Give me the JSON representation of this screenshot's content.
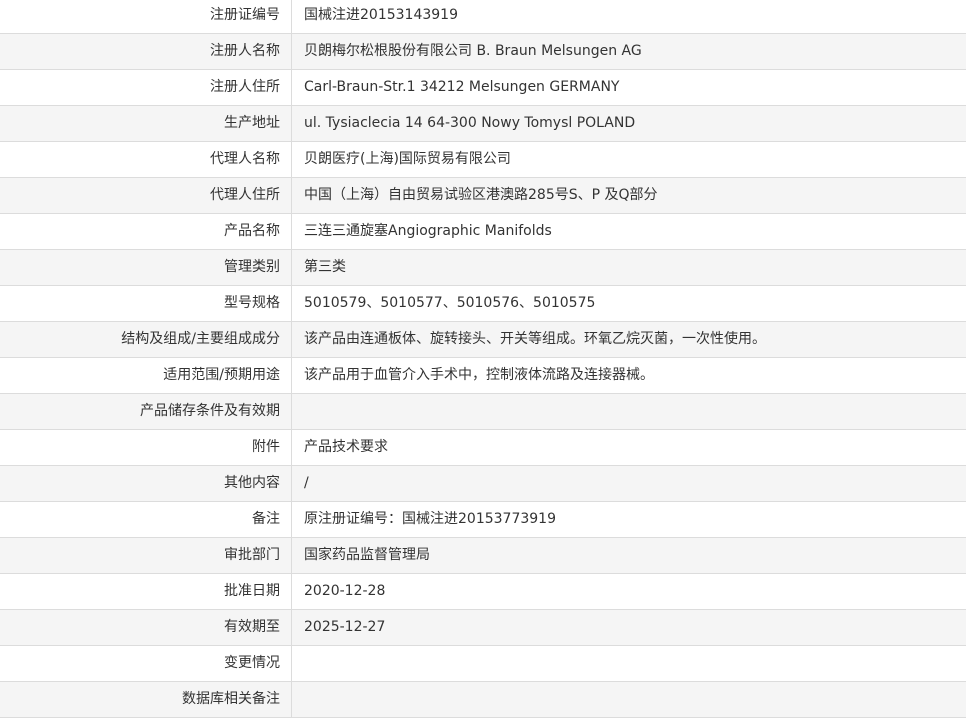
{
  "rows": [
    {
      "label": "注册证编号",
      "value": "国械注进20153143919"
    },
    {
      "label": "注册人名称",
      "value": "贝朗梅尔松根股份有限公司 B. Braun Melsungen AG"
    },
    {
      "label": "注册人住所",
      "value": "Carl-Braun-Str.1 34212 Melsungen GERMANY"
    },
    {
      "label": "生产地址",
      "value": "ul. Tysiaclecia 14 64-300 Nowy Tomysl POLAND"
    },
    {
      "label": "代理人名称",
      "value": "贝朗医疗(上海)国际贸易有限公司"
    },
    {
      "label": "代理人住所",
      "value": "中国（上海）自由贸易试验区港澳路285号S、P 及Q部分"
    },
    {
      "label": "产品名称",
      "value": "三连三通旋塞Angiographic Manifolds"
    },
    {
      "label": "管理类别",
      "value": "第三类"
    },
    {
      "label": "型号规格",
      "value": "5010579、5010577、5010576、5010575"
    },
    {
      "label": "结构及组成/主要组成成分",
      "value": "该产品由连通板体、旋转接头、开关等组成。环氧乙烷灭菌，一次性使用。"
    },
    {
      "label": "适用范围/预期用途",
      "value": "该产品用于血管介入手术中，控制液体流路及连接器械。"
    },
    {
      "label": "产品储存条件及有效期",
      "value": ""
    },
    {
      "label": "附件",
      "value": "产品技术要求"
    },
    {
      "label": "其他内容",
      "value": "/"
    },
    {
      "label": "备注",
      "value": "原注册证编号：国械注进20153773919"
    },
    {
      "label": "审批部门",
      "value": "国家药品监督管理局"
    },
    {
      "label": "批准日期",
      "value": "2020-12-28"
    },
    {
      "label": "有效期至",
      "value": "2025-12-27"
    },
    {
      "label": "变更情况",
      "value": ""
    },
    {
      "label": "数据库相关备注",
      "value": ""
    }
  ]
}
